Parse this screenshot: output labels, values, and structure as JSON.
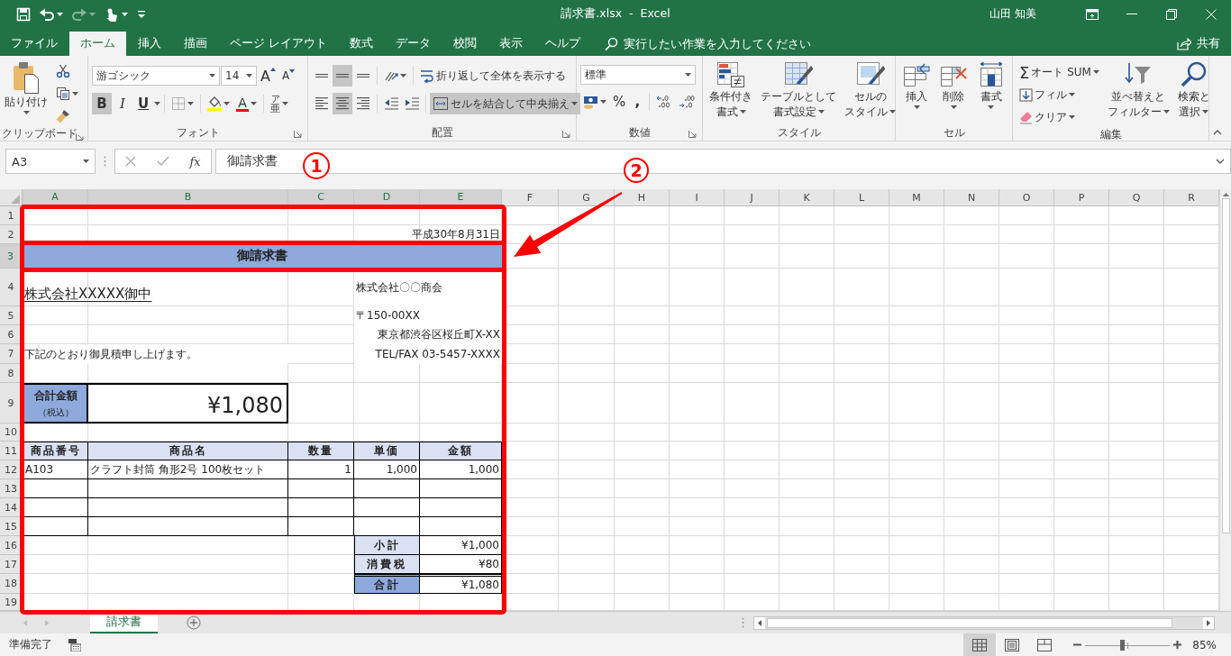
{
  "title_bar": {
    "quick_access": [
      {
        "kind": "save",
        "disabled": false
      },
      {
        "kind": "undo",
        "disabled": false
      },
      {
        "kind": "redo",
        "disabled": true
      },
      {
        "kind": "touch",
        "disabled": false
      },
      {
        "kind": "customize",
        "disabled": false
      }
    ],
    "title": "請求書.xlsx  -  Excel",
    "user": "山田 知美"
  },
  "tabs": [
    {
      "label": "ファイル",
      "selected": false
    },
    {
      "label": "ホーム",
      "selected": true
    },
    {
      "label": "挿入",
      "selected": false
    },
    {
      "label": "描画",
      "selected": false
    },
    {
      "label": "ページ レイアウト",
      "selected": false
    },
    {
      "label": "数式",
      "selected": false
    },
    {
      "label": "データ",
      "selected": false
    },
    {
      "label": "校閲",
      "selected": false
    },
    {
      "label": "表示",
      "selected": false
    },
    {
      "label": "ヘルプ",
      "selected": false
    }
  ],
  "tell_me": {
    "placeholder": "実行したい作業を入力してください"
  },
  "share": "共有",
  "ribbon": {
    "groups": [
      {
        "kind": "clipboard",
        "label": "クリップボード",
        "launcher": true,
        "paste": "貼り付け"
      },
      {
        "kind": "font",
        "label": "フォント",
        "launcher": true,
        "font_name": "游ゴシック",
        "font_size": "14",
        "grow": "A",
        "shrink": "A",
        "bold": {
          "glyph": "B",
          "on": true
        },
        "italic": {
          "glyph": "I",
          "on": false
        },
        "underline": {
          "glyph": "U",
          "on": false
        },
        "font_color": "A",
        "phonetic": [
          "ア",
          "亜"
        ]
      },
      {
        "kind": "alignment",
        "label": "配置",
        "launcher": true,
        "vertical": [
          {
            "selected": false
          },
          {
            "selected": true
          },
          {
            "selected": false
          }
        ],
        "horizontal": [
          {
            "selected": false
          },
          {
            "selected": true
          },
          {
            "selected": false
          }
        ],
        "wrap": {
          "label": "折り返して全体を表示する",
          "on": false
        },
        "merge": {
          "label": "セルを結合して中央揃え",
          "on": true
        }
      },
      {
        "kind": "number",
        "label": "数値",
        "launcher": true,
        "format": "標準",
        "percent": "%",
        "comma": ","
      },
      {
        "kind": "styles",
        "label": "スタイル",
        "launcher": false,
        "buttons": [
          {
            "lines": [
              "条件付き",
              "書式"
            ]
          },
          {
            "lines": [
              "テーブルとして",
              "書式設定"
            ]
          },
          {
            "lines": [
              "セルの",
              "スタイル"
            ]
          }
        ]
      },
      {
        "kind": "cells",
        "label": "セル",
        "launcher": false,
        "buttons": [
          {
            "lines": [
              "挿入"
            ]
          },
          {
            "lines": [
              "削除"
            ]
          },
          {
            "lines": [
              "書式"
            ]
          }
        ]
      },
      {
        "kind": "editing",
        "label": "編集",
        "launcher": false,
        "sum": {
          "glyph": "Σ",
          "label": "オート SUM"
        },
        "fill": "フィル",
        "clear": "クリア",
        "buttons": [
          {
            "lines": [
              "並べ替えと",
              "フィルター"
            ]
          },
          {
            "lines": [
              "検索と",
              "選択"
            ]
          }
        ]
      }
    ]
  },
  "formula_bar": {
    "name_box": "A3",
    "function_glyph": "fx",
    "formula": "御請求書"
  },
  "sheet": {
    "columns": [
      {
        "label": "A",
        "selected": true
      },
      {
        "label": "B",
        "selected": true
      },
      {
        "label": "C",
        "selected": true
      },
      {
        "label": "D",
        "selected": true
      },
      {
        "label": "E",
        "selected": true
      },
      {
        "label": "F",
        "selected": false
      },
      {
        "label": "G",
        "selected": false
      },
      {
        "label": "H",
        "selected": false
      },
      {
        "label": "I",
        "selected": false
      },
      {
        "label": "J",
        "selected": false
      },
      {
        "label": "K",
        "selected": false
      },
      {
        "label": "L",
        "selected": false
      },
      {
        "label": "M",
        "selected": false
      },
      {
        "label": "N",
        "selected": false
      },
      {
        "label": "O",
        "selected": false
      },
      {
        "label": "P",
        "selected": false
      },
      {
        "label": "Q",
        "selected": false
      },
      {
        "label": "R",
        "selected": false
      }
    ],
    "rows": [
      {
        "label": "1",
        "selected": false
      },
      {
        "label": "2",
        "selected": false
      },
      {
        "label": "3",
        "selected": true
      },
      {
        "label": "4",
        "selected": false
      },
      {
        "label": "5",
        "selected": false
      },
      {
        "label": "6",
        "selected": false
      },
      {
        "label": "7",
        "selected": false
      },
      {
        "label": "8",
        "selected": false
      },
      {
        "label": "9",
        "selected": false
      },
      {
        "label": "10",
        "selected": false
      },
      {
        "label": "11",
        "selected": false
      },
      {
        "label": "12",
        "selected": false
      },
      {
        "label": "13",
        "selected": false
      },
      {
        "label": "14",
        "selected": false
      },
      {
        "label": "15",
        "selected": false
      },
      {
        "label": "16",
        "selected": false
      },
      {
        "label": "17",
        "selected": false
      },
      {
        "label": "18",
        "selected": false
      },
      {
        "label": "19",
        "selected": false
      }
    ],
    "invoice": {
      "date": "平成30年8月31日",
      "title": "御請求書",
      "addressee": "株式会社XXXXX御中",
      "issuer": [
        {
          "text": "株式会社〇〇商会",
          "align_right": false
        },
        {
          "text": "〒150-00XX",
          "align_right": false
        },
        {
          "text": "東京都渋谷区桜丘町X-XX",
          "align_right": true
        },
        {
          "text": "TEL/FAX 03-5457-XXXX",
          "align_right": true
        }
      ],
      "greeting": "下記のとおり御見積申し上げます。",
      "total": {
        "label": "合計金額",
        "note": "（税込）",
        "amount": "¥1,080"
      },
      "headers": [
        "商品番号",
        "商品名",
        "数量",
        "単価",
        "金額"
      ],
      "items": [
        {
          "code": "A103",
          "name": "クラフト封筒 角形2号 100枚セット",
          "qty": "1",
          "price": "1,000",
          "amount": "1,000"
        }
      ],
      "summary": [
        {
          "label": "小計",
          "value": "¥1,000",
          "emphasis": false
        },
        {
          "label": "消費税",
          "value": "¥80",
          "emphasis": false
        },
        {
          "label": "合計",
          "value": "¥1,080",
          "emphasis": true
        }
      ]
    }
  },
  "sheet_tabs": [
    {
      "label": "請求書",
      "selected": true
    }
  ],
  "status": {
    "text": "準備完了",
    "views": [
      {
        "selected": true
      },
      {
        "selected": false
      },
      {
        "selected": false
      }
    ],
    "zoom": {
      "level": 0.43,
      "label": "85%"
    }
  },
  "annotations": [
    {
      "label": "1"
    },
    {
      "label": "2"
    }
  ]
}
